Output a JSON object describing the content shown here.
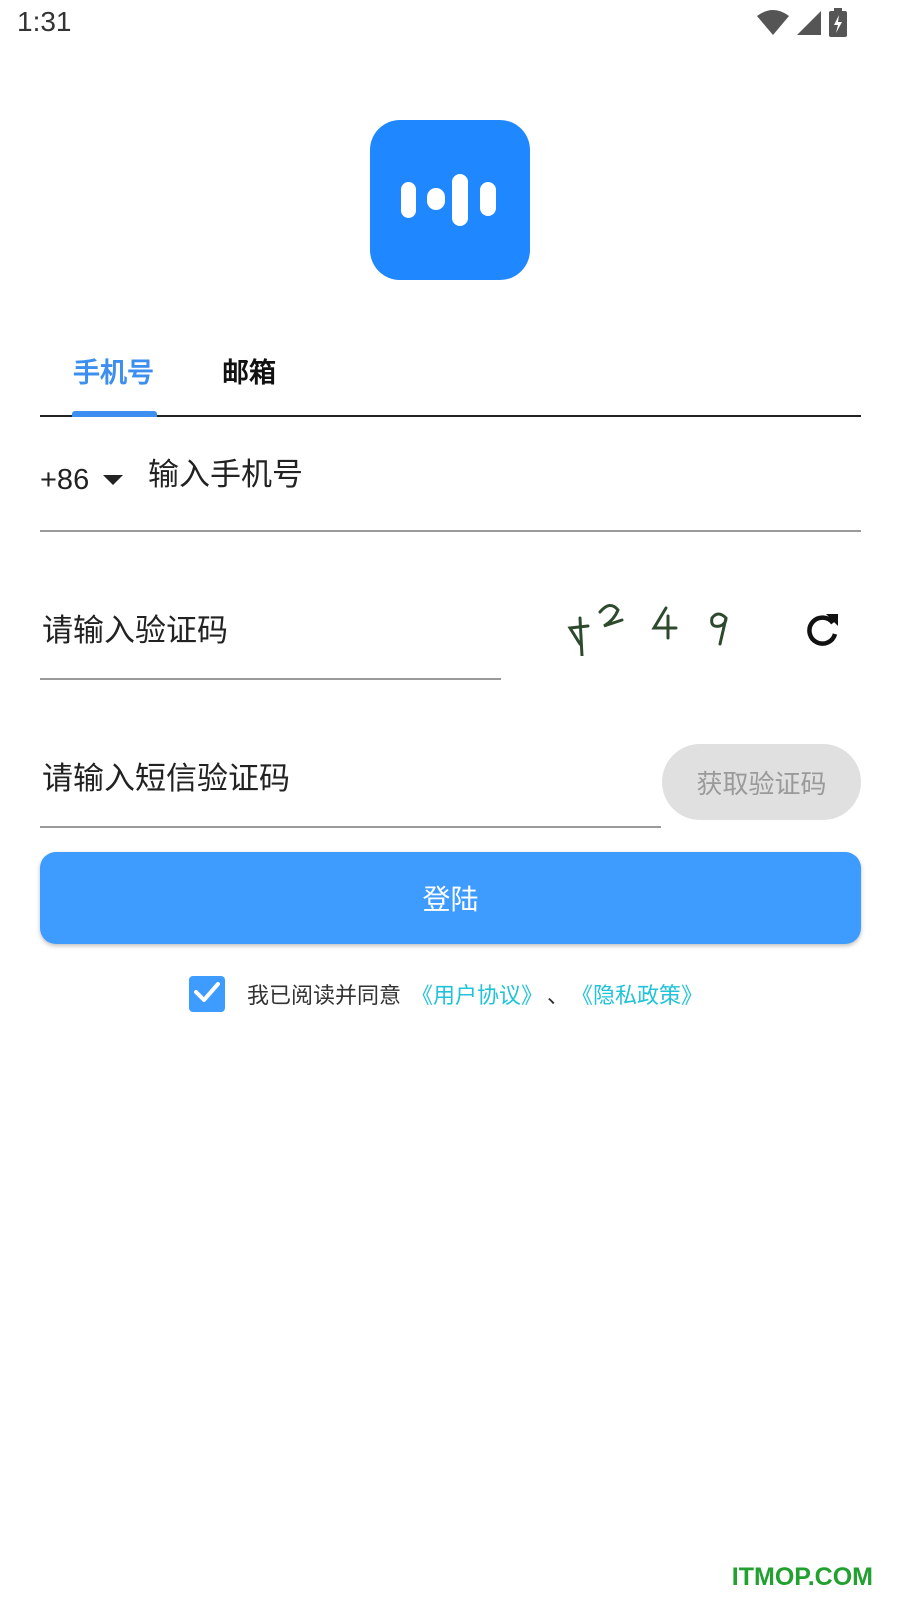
{
  "status_bar": {
    "time": "1:31",
    "icons": [
      "wifi-icon",
      "signal-icon",
      "battery-charging-icon"
    ]
  },
  "logo": {
    "icon": "sound-wave-icon",
    "color": "#1f87ff"
  },
  "tabs": [
    {
      "label": "手机号",
      "active": true
    },
    {
      "label": "邮箱",
      "active": false
    }
  ],
  "phone": {
    "country_code": "+86",
    "placeholder": "输入手机号"
  },
  "captcha": {
    "placeholder": "请输入验证码",
    "image_text": "4249"
  },
  "sms": {
    "placeholder": "请输入短信验证码",
    "button_label": "获取验证码"
  },
  "login": {
    "button_label": "登陆"
  },
  "agreement": {
    "checked": true,
    "text": "我已阅读并同意",
    "user_agreement": "《用户协议》",
    "separator": "、",
    "privacy_policy": "《隐私政策》"
  },
  "colors": {
    "primary": "#3e9bff",
    "tab_active": "#3d8fef",
    "link": "#21c3d8"
  },
  "watermark": "ITMOP.COM"
}
